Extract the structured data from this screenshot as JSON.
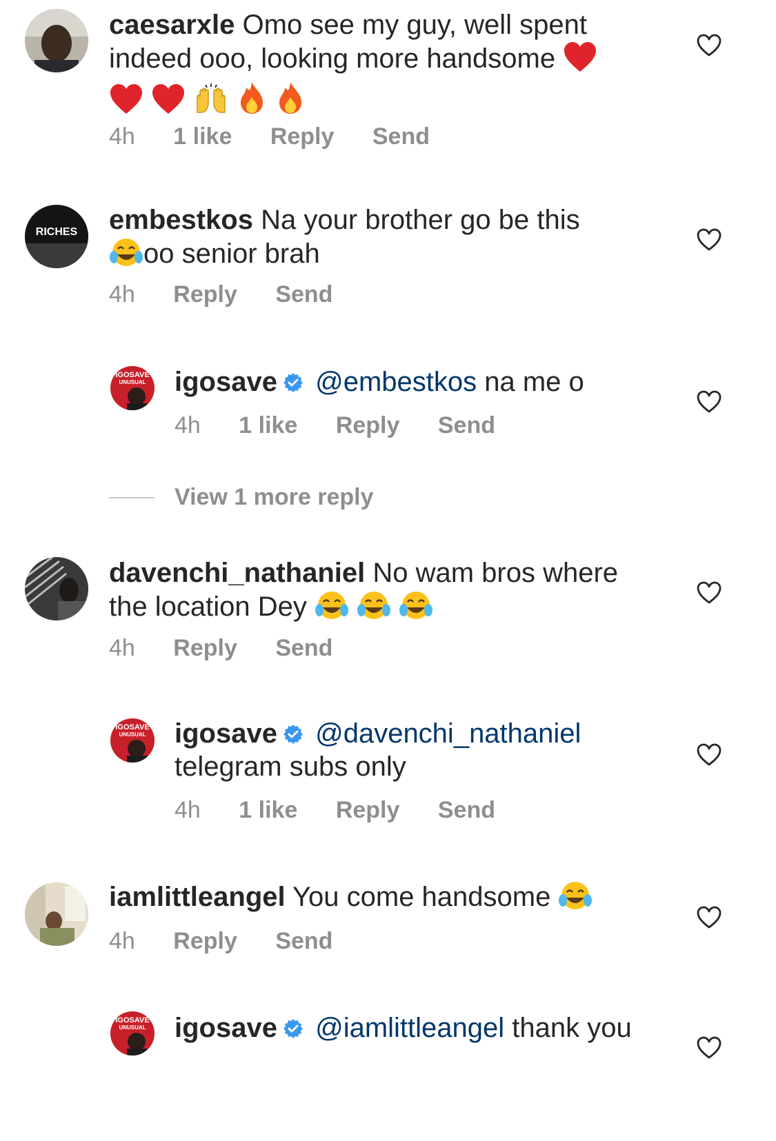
{
  "comments": [
    {
      "username": "caesarxle",
      "text": "Omo see my guy, well spent indeed ooo, looking more handsome",
      "time": "4h",
      "likes": "1 like",
      "reply": "Reply",
      "send": "Send"
    },
    {
      "username": "embestkos",
      "text_a": "Na your brother go be this",
      "text_b": "oo senior brah",
      "time": "4h",
      "reply": "Reply",
      "send": "Send",
      "avatar_text": "RICHES"
    },
    {
      "username": "igosave",
      "mention": "@embestkos",
      "text": "na me o",
      "time": "4h",
      "likes": "1 like",
      "reply": "Reply",
      "send": "Send"
    },
    {
      "username": "davenchi_nathaniel",
      "text": "No wam bros where the location Dey",
      "time": "4h",
      "reply": "Reply",
      "send": "Send"
    },
    {
      "username": "igosave",
      "mention": "@davenchi_nathaniel",
      "text": "telegram subs only",
      "time": "4h",
      "likes": "1 like",
      "reply": "Reply",
      "send": "Send"
    },
    {
      "username": "iamlittleangel",
      "text": "You come handsome",
      "time": "4h",
      "reply": "Reply",
      "send": "Send"
    },
    {
      "username": "igosave",
      "mention": "@iamlittleangel",
      "text": "thank you"
    }
  ],
  "view_more": "View 1 more reply",
  "igosave_avatar_text": {
    "line1": "IGOSAVE",
    "line2": "UNUSUAL"
  },
  "colors": {
    "text": "#262626",
    "meta": "#8e8e8e",
    "mention": "#00376b",
    "verified": "#3897f0"
  }
}
